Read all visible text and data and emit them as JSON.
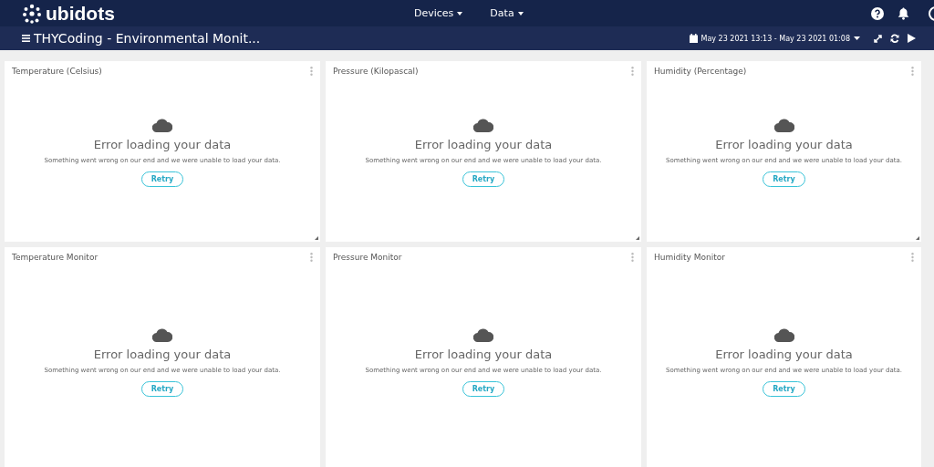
{
  "brand": "ubidots",
  "nav": [
    {
      "label": "Devices"
    },
    {
      "label": "Data"
    }
  ],
  "dashboard": {
    "title": "THYCoding - Environmental Monit...",
    "date_range": "May 23 2021 13:13 - May 23 2021 01:08"
  },
  "widgets": [
    {
      "title": "Temperature (Celsius)",
      "error_title": "Error loading your data",
      "error_message": "Something went wrong on our end and we were unable to load your data.",
      "button": "Retry"
    },
    {
      "title": "Pressure (Kilopascal)",
      "error_title": "Error loading your data",
      "error_message": "Something went wrong on our end and we were unable to load your data.",
      "button": "Retry"
    },
    {
      "title": "Humidity (Percentage)",
      "error_title": "Error loading your data",
      "error_message": "Something went wrong on our end and we were unable to load your data.",
      "button": "Retry"
    },
    {
      "title": "Temperature Monitor",
      "error_title": "Error loading your data",
      "error_message": "Something went wrong on our end and we were unable to load your data.",
      "button": "Retry"
    },
    {
      "title": "Pressure Monitor",
      "error_title": "Error loading your data",
      "error_message": "Something went wrong on our end and we were unable to load your data.",
      "button": "Retry"
    },
    {
      "title": "Humidity Monitor",
      "error_title": "Error loading your data",
      "error_message": "Something went wrong on our end and we were unable to load your data.",
      "button": "Retry"
    }
  ]
}
